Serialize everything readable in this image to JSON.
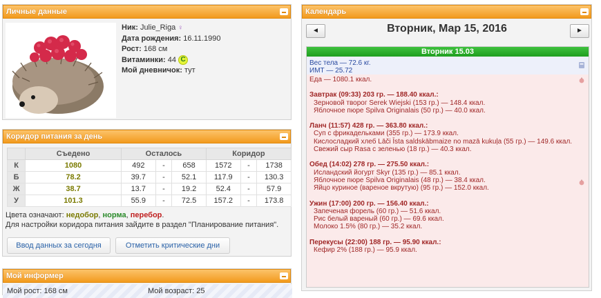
{
  "personal": {
    "title": "Личные данные",
    "nick_label": "Ник:",
    "nick": "Julie_Riga",
    "dob_label": "Дата рождения:",
    "dob": "16.11.1990",
    "height_label": "Рост:",
    "height": "168 см",
    "vitamins_label": "Витаминки:",
    "vitamins": "44",
    "vitamin_badge": "C",
    "diary_label": "Мой дневничок:",
    "diary": "тут"
  },
  "corridor": {
    "title": "Коридор питания за день",
    "headers": [
      "Съедено",
      "Осталось",
      "Коридор"
    ],
    "rows": [
      {
        "label": "К",
        "eaten": "1080",
        "left_min": "492",
        "left_max": "658",
        "cor_min": "1572",
        "cor_max": "1738"
      },
      {
        "label": "Б",
        "eaten": "78.2",
        "left_min": "39.7",
        "left_max": "52.1",
        "cor_min": "117.9",
        "cor_max": "130.3"
      },
      {
        "label": "Ж",
        "eaten": "38.7",
        "left_min": "13.7",
        "left_max": "19.2",
        "cor_min": "52.4",
        "cor_max": "57.9"
      },
      {
        "label": "У",
        "eaten": "101.3",
        "left_min": "55.9",
        "left_max": "72.5",
        "cor_min": "157.2",
        "cor_max": "173.8"
      }
    ],
    "dash": "-",
    "legend_prefix": "Цвета означают:",
    "legend_under": "недобор",
    "legend_sep1": ",",
    "legend_norm": "норма",
    "legend_sep2": ",",
    "legend_over": "перебор",
    "legend_end": ".",
    "note": "Для настройки коридора питания зайдите в раздел \"Планирование питания\".",
    "btn_today": "Ввод данных за сегодня",
    "btn_critical": "Отметить критические дни"
  },
  "informer": {
    "title": "Мой информер",
    "height": "Мой рост: 168 см",
    "age": "Мой возраст: 25"
  },
  "calendar": {
    "title_panel": "Календарь",
    "prev": "◄",
    "next": "►",
    "date_title": "Вторник, Мар 15, 2016",
    "day_head": "Вторник 15.03",
    "weight": "Вес тела — 72.6 кг.",
    "bmi": "ИМТ — 25.72",
    "food_total": "Еда — 1080.1 ккал.",
    "meals": [
      {
        "title": "Завтрак (09:33) 203 гр. — 188.40 ккал.:",
        "items": [
          "Зерновой творог Serek Wiejski (153 гр.) — 148.4 ккал.",
          "Яблочное пюре Spilva Originalais (50 гр.) — 40.0 ккал."
        ]
      },
      {
        "title": "Ланч (11:57) 428 гр. — 363.80 ккал.:",
        "items": [
          "Суп с фрикадельками (355 гр.) — 173.9 ккал.",
          "Кисло­сладкий хлеб Lāči Īsta saldskābmaize no mazā kukuļa (55 гр.) — 149.6 ккал.",
          "Свежий сыр Rasa с зеленью (18 гр.) — 40.3 ккал."
        ]
      },
      {
        "title": "Обед (14:02) 278 гр. — 275.50 ккал.:",
        "items": [
          "Исландский йогурт Skyr (135 гр.) — 85.1 ккал.",
          "Яблочное пюре Spilva Originalais (48 гр.) — 38.4 ккал.",
          "Яйцо куриное (вареное вкрутую) (95 гр.) — 152.0 ккал."
        ]
      },
      {
        "title": "Ужин (17:00) 200 гр. — 156.40 ккал.:",
        "items": [
          "Запеченая форель (60 гр.) — 51.6 ккал.",
          "Рис белый вареный (60 гр.) — 69.6 ккал.",
          "Молоко 1.5% (80 гр.) — 35.2 ккал."
        ]
      },
      {
        "title": "Перекусы (22:00) 188 гр. — 95.90 ккал.:",
        "items": [
          "Кефир 2% (188 гр.) — 95.9 ккал."
        ]
      }
    ]
  },
  "colors": {
    "panel_header": "#f29a1e",
    "day_header": "#1f9e1f",
    "food_bg": "#fbeaea",
    "food_text": "#a02828",
    "weight_text": "#2a4aa0",
    "link": "#2a62a8"
  }
}
